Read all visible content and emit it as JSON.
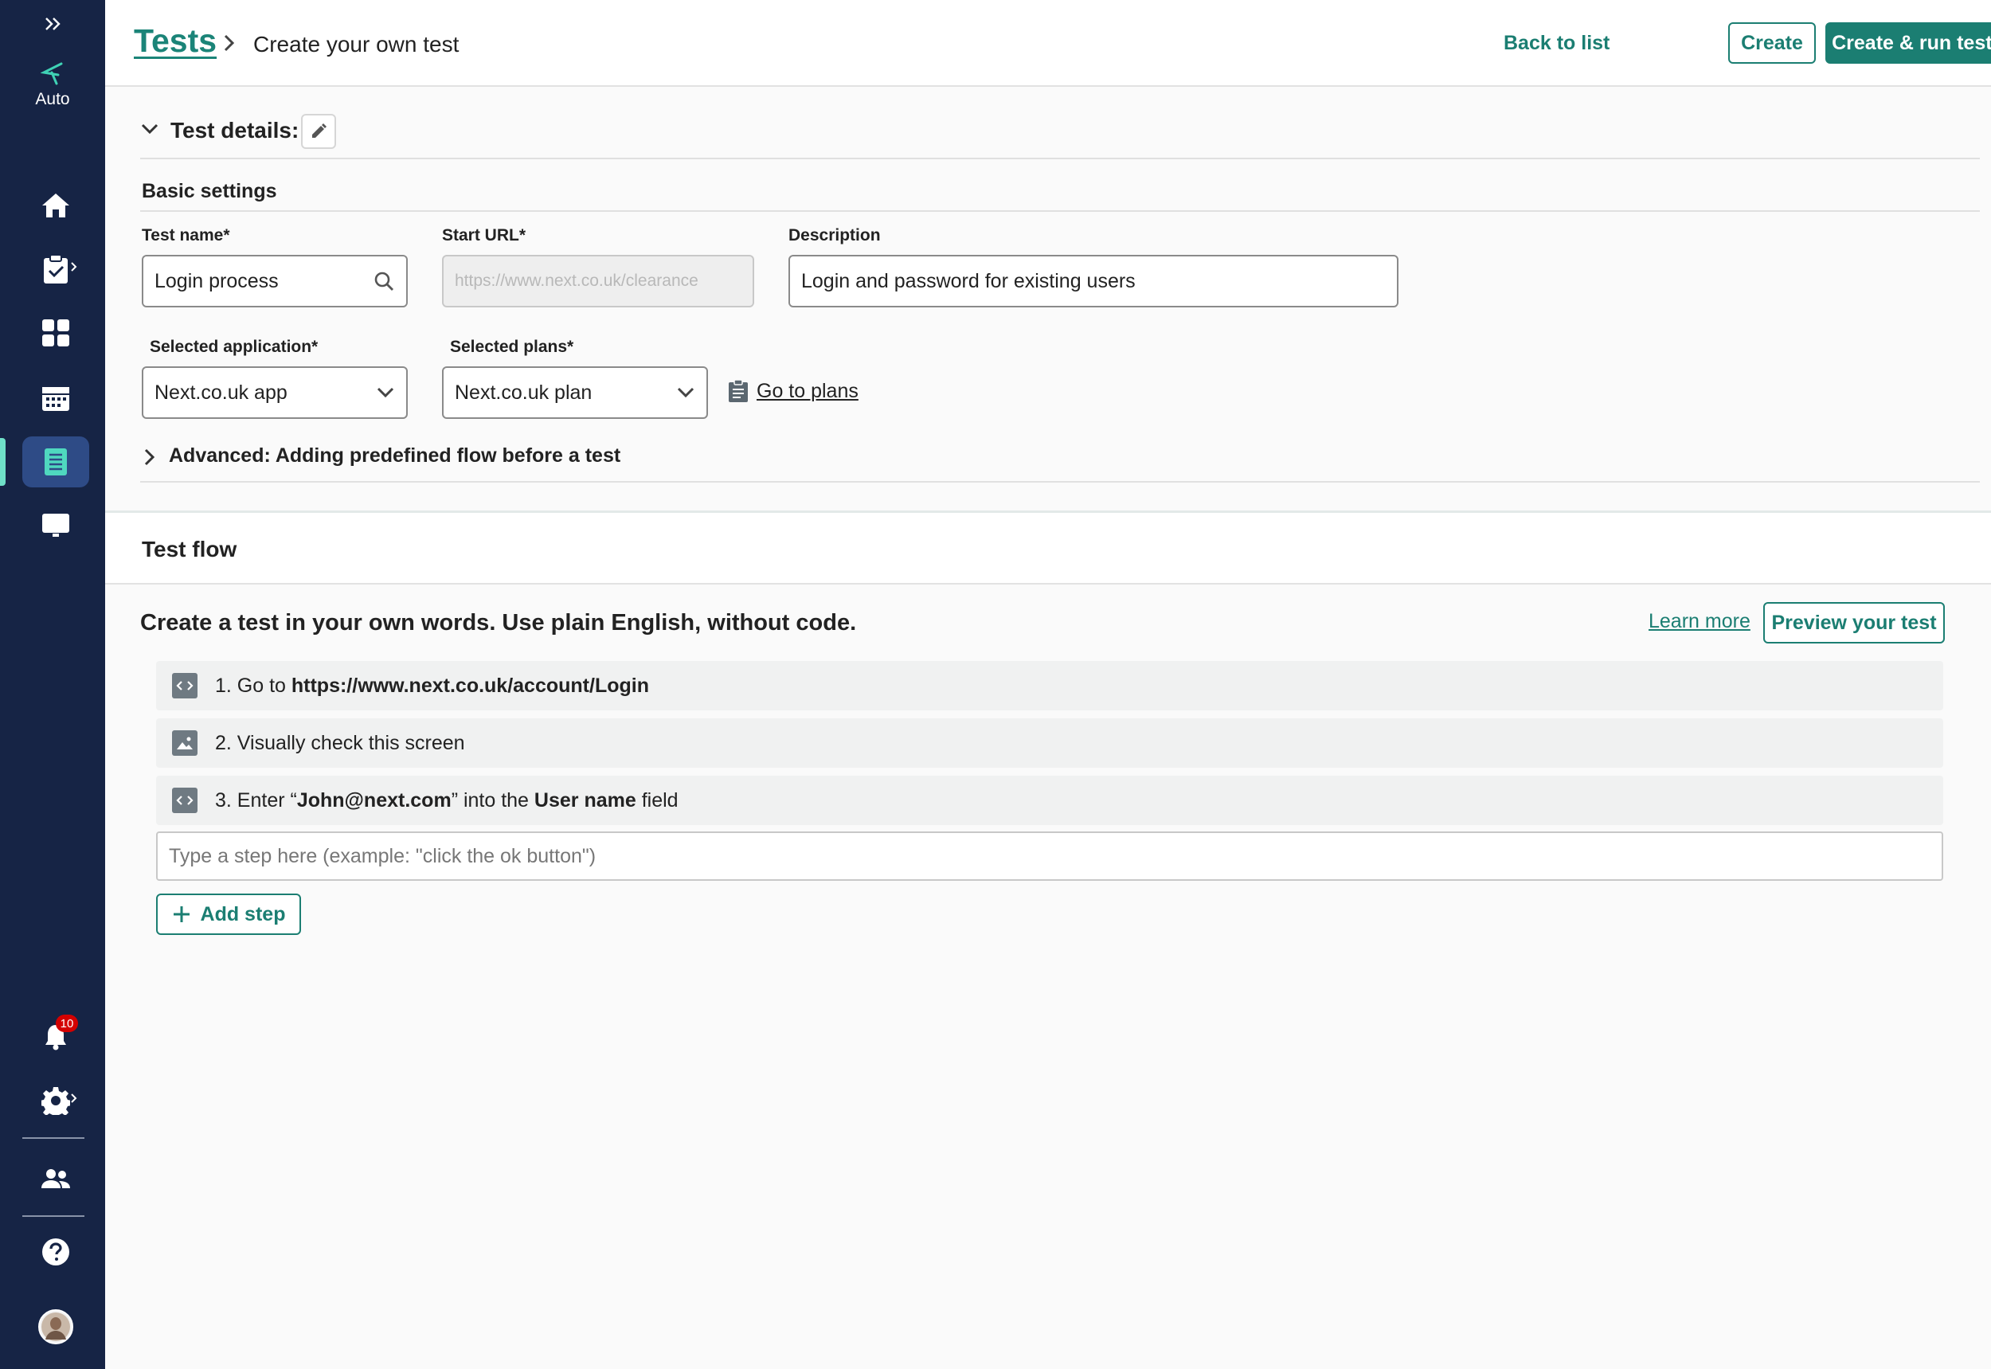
{
  "sidebar": {
    "logo_label": "Auto",
    "notification_count": "10",
    "items": [
      {
        "name": "home-icon"
      },
      {
        "name": "clipboard-check-icon"
      },
      {
        "name": "dashboard-grid-icon"
      },
      {
        "name": "calendar-icon"
      },
      {
        "name": "document-list-icon",
        "active": true
      },
      {
        "name": "monitor-icon"
      }
    ]
  },
  "header": {
    "breadcrumb_root": "Tests",
    "breadcrumb_current": "Create your own test",
    "back_label": "Back to list",
    "create_label": "Create",
    "create_run_label": "Create & run test plan"
  },
  "details": {
    "section_title": "Test details:",
    "basic_settings_title": "Basic settings",
    "test_name": {
      "label": "Test name*",
      "value": "Login process"
    },
    "start_url": {
      "label": "Start URL*",
      "value": "https://www.next.co.uk/clearance"
    },
    "description": {
      "label": "Description",
      "value": "Login and password for existing users"
    },
    "selected_application": {
      "label": "Selected application*",
      "value": "Next.co.uk app"
    },
    "selected_plans": {
      "label": "Selected plans*",
      "value": "Next.co.uk plan"
    },
    "go_to_plans": "Go to plans",
    "advanced_label": "Advanced: Adding predefined flow before a test"
  },
  "flow": {
    "title": "Test flow",
    "subtitle": "Create a test in your own words. Use plain English, without code.",
    "learn_more": "Learn more",
    "preview_label": "Preview your test",
    "steps": [
      {
        "prefix": "1. Go to ",
        "bold1": "https://www.next.co.uk/account/Login",
        "icon": "code-icon"
      },
      {
        "prefix": "2. Visually check this screen",
        "icon": "image-icon"
      },
      {
        "prefix": "3. Enter “",
        "bold1": "John@next.com",
        "mid": "” into the ",
        "bold2": "User name",
        "suffix": " field",
        "icon": "code-icon"
      }
    ],
    "step_placeholder": "Type a step here (example: \"click the ok button\")",
    "add_step_label": "Add step"
  },
  "colors": {
    "sidebar_bg": "#162445",
    "accent": "#1b7e72",
    "active_item": "#2e4b86"
  }
}
